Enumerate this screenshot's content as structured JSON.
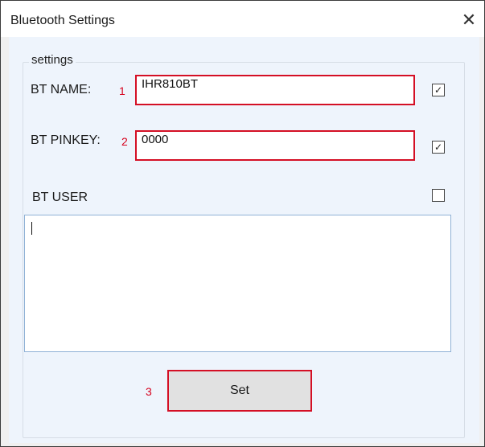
{
  "window": {
    "title": "Bluetooth Settings",
    "close_glyph": "✕"
  },
  "group": {
    "title": "settings"
  },
  "bt_name": {
    "label": "BT NAME:",
    "marker": "1",
    "value": "IHR810BT",
    "checked": true,
    "check_glyph": "✓"
  },
  "bt_pinkey": {
    "label": "BT PINKEY:",
    "marker": "2",
    "value": "0000",
    "checked": true,
    "check_glyph": "✓"
  },
  "bt_user": {
    "label": "BT USER",
    "checked": false,
    "value": ""
  },
  "set_button": {
    "marker": "3",
    "label": "Set"
  },
  "colors": {
    "highlight_border": "#d40f25",
    "client_bg": "#eef4fc"
  }
}
